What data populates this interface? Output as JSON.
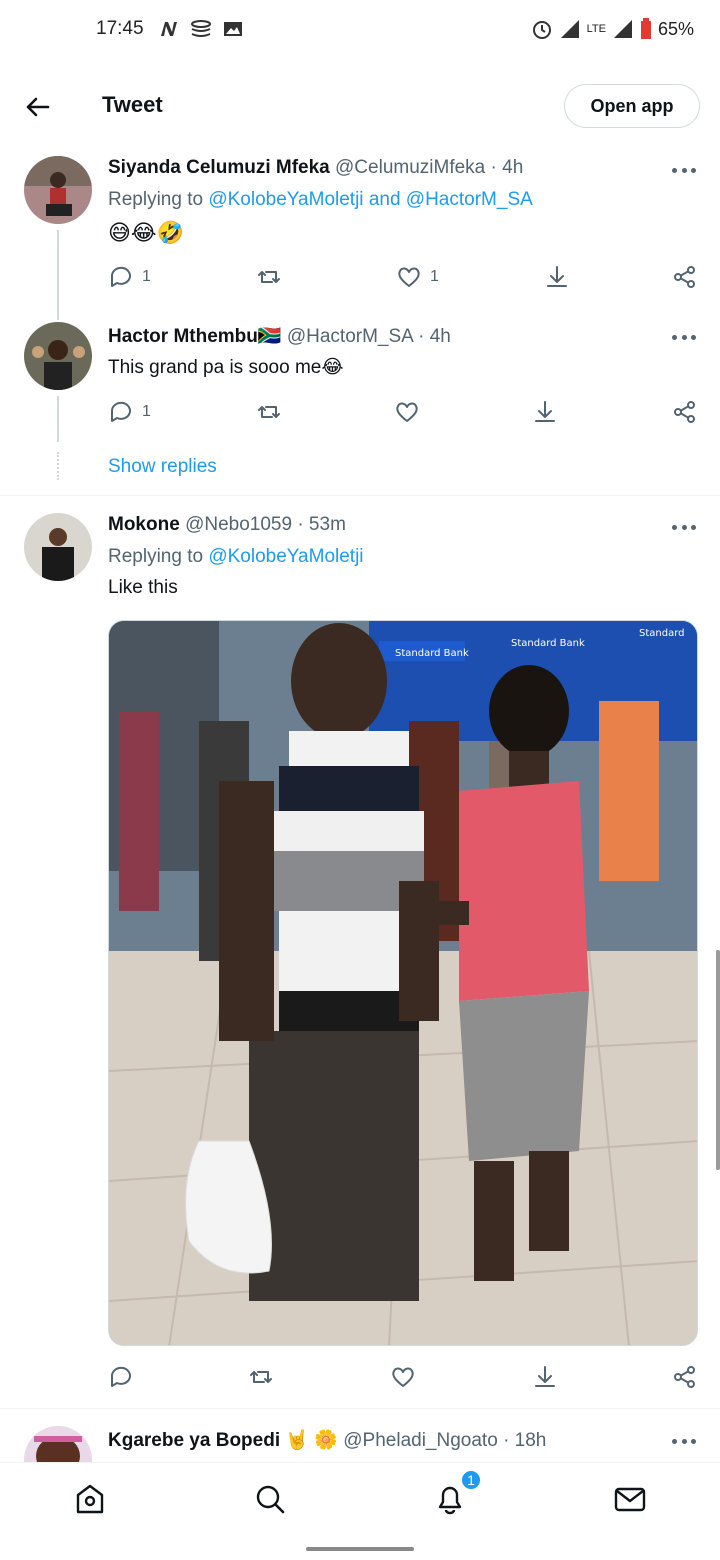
{
  "status_bar": {
    "time": "17:45",
    "battery": "65%",
    "network": "LTE",
    "left_icons": [
      "n-icon",
      "stack-icon",
      "image-icon"
    ],
    "right_icons": [
      "alarm-icon",
      "signal-icon",
      "lte-icon",
      "signal-icon",
      "battery-icon"
    ]
  },
  "header": {
    "title": "Tweet",
    "open_app_label": "Open app"
  },
  "tweets": [
    {
      "name": "Siyanda Celumuzi Mfeka",
      "handle": "@CelumuziMfeka",
      "time": "· 4h",
      "replying_prefix": "Replying to",
      "mentions": [
        "@KolobeYaMoletji",
        "@HactorM_SA"
      ],
      "mention_joiner": "and",
      "text": "😅😂🤣",
      "reply_count": "1",
      "like_count": "1"
    },
    {
      "name": "Hactor Mthembu",
      "name_emoji": "🇿🇦",
      "handle": "@HactorM_SA",
      "time": "· 4h",
      "text": "This grand pa is sooo me😂",
      "reply_count": "1",
      "like_count": ""
    },
    {
      "name": "Mokone",
      "handle": "@Nebo1059",
      "time": "· 53m",
      "replying_prefix": "Replying to",
      "mentions": [
        "@KolobeYaMoletji"
      ],
      "text": "Like this",
      "media_signs": [
        "Standard Bank",
        "Standard Bank",
        "Standard"
      ]
    },
    {
      "name": "Kgarebe ya Bopedi",
      "name_emoji": "🤘 🌼",
      "handle": "@Pheladi_Ngoato",
      "time": "· 18h"
    }
  ],
  "show_replies_label": "Show replies",
  "bottom_nav": {
    "items": [
      "home-icon",
      "search-icon",
      "notifications-icon",
      "messages-icon"
    ],
    "notification_badge": "1"
  },
  "colors": {
    "accent": "#1d9bf0",
    "secondary_text": "#536471",
    "border": "#cfd9de"
  }
}
